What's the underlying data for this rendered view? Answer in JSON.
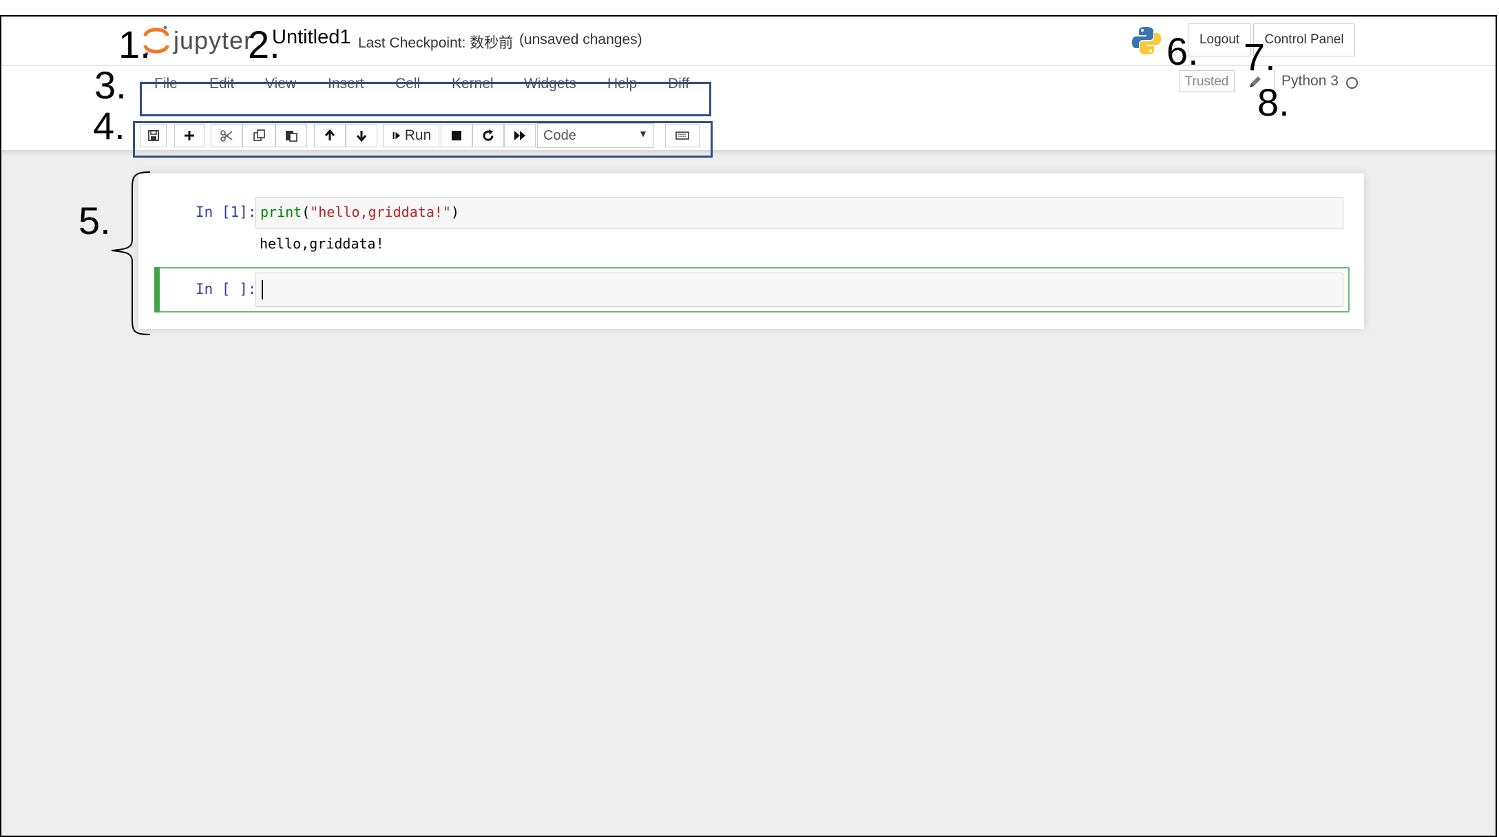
{
  "header": {
    "logo_text": "jupyter",
    "notebook_name": "Untitled1",
    "checkpoint": "Last Checkpoint: 数秒前",
    "unsaved": "(unsaved changes)",
    "logout_label": "Logout",
    "control_panel_label": "Control Panel"
  },
  "menubar": {
    "items": [
      "File",
      "Edit",
      "View",
      "Insert",
      "Cell",
      "Kernel",
      "Widgets",
      "Help",
      "Diff"
    ],
    "trusted_label": "Trusted",
    "kernel_name": "Python 3"
  },
  "toolbar": {
    "run_label": "Run",
    "cell_type": "Code",
    "icons": [
      "save-icon",
      "plus-icon",
      "scissors-icon",
      "copy-icon",
      "paste-icon",
      "arrow-up-icon",
      "arrow-down-icon",
      "step-forward-icon",
      "stop-icon",
      "restart-icon",
      "fast-forward-icon",
      "keyboard-icon"
    ]
  },
  "cells": [
    {
      "prompt": "In [1]:",
      "code_func": "print",
      "code_open": "(",
      "code_string": "\"hello,griddata!\"",
      "code_close": ")",
      "output": "hello,griddata!"
    },
    {
      "prompt": "In [ ]:"
    }
  ],
  "annotations": [
    "1.",
    "2.",
    "3.",
    "4.",
    "5.",
    "6.",
    "7.",
    "8."
  ],
  "colors": {
    "logo_orange": "#f37726",
    "annotation_box": "#2f4f7f",
    "selected_cell": "#66bb6a",
    "prompt_blue": "#303f9f",
    "notebook_background": "#eeeeee"
  }
}
